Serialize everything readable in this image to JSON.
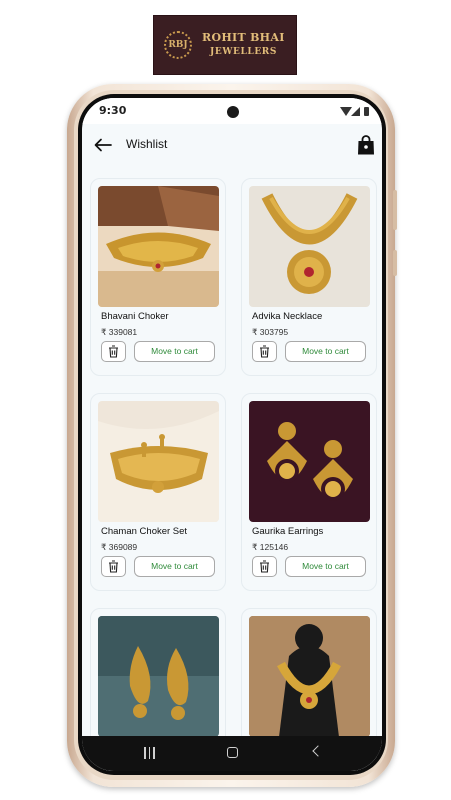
{
  "brand": {
    "monogram": "RBJ",
    "line1": "ROHIT BHAI",
    "line2": "JEWELLERS"
  },
  "status": {
    "time": "9:30"
  },
  "header": {
    "title": "Wishlist"
  },
  "items": [
    {
      "name": "Bhavani Choker",
      "price": "₹ 339081",
      "action": "Move to cart"
    },
    {
      "name": "Advika Necklace",
      "price": "₹ 303795",
      "action": "Move to cart"
    },
    {
      "name": "Chaman Choker Set",
      "price": "₹ 369089",
      "action": "Move to cart"
    },
    {
      "name": "Gaurika Earrings",
      "price": "₹ 125146",
      "action": "Move to cart"
    },
    {
      "name": "",
      "price": "",
      "action": ""
    },
    {
      "name": "",
      "price": "",
      "action": ""
    }
  ],
  "colors": {
    "accent_green": "#2f8a3a",
    "logo_bg": "#3a1e22",
    "gold": "#e2bd7a"
  },
  "icons": [
    "back-arrow-icon",
    "shopping-bag-icon",
    "trash-icon",
    "wifi-icon",
    "signal-icon",
    "battery-icon",
    "nav-recents-icon",
    "nav-home-icon",
    "nav-back-icon"
  ]
}
